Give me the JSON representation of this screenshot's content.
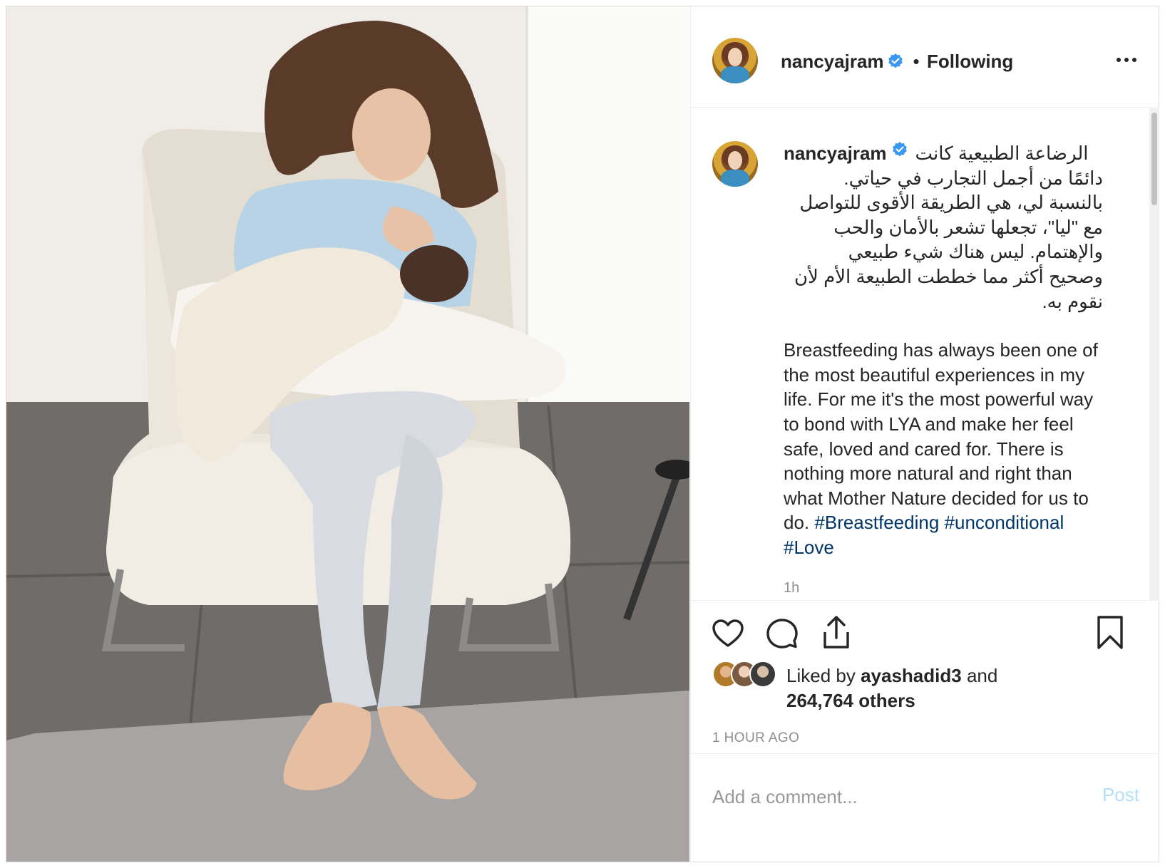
{
  "post": {
    "username": "nancyajram",
    "follow_status": "Following",
    "separator": "•",
    "caption_arabic_first": "الرضاعة الطبيعية كانت",
    "caption_arabic_lines": [
      "دائمًا من أجمل التجارب في حياتي.",
      "بالنسبة لي، هي الطريقة الأقوى للتواصل",
      "مع \"ليا\"، تجعلها تشعر بالأمان والحب",
      "والإهتمام. ليس هناك شيء طبيعي",
      "وصحيح أكثر مما خططت الطبيعة الأم لأن",
      "نقوم به."
    ],
    "caption_english": "Breastfeeding has always been one of the most beautiful experiences in my life. For me it's the most powerful way to bond with LYA and make her feel safe, loved and cared for. There is nothing more natural and right than what Mother Nature decided for us to do.",
    "hashtags": [
      "#Breastfeeding",
      "#unconditional",
      "#Love"
    ],
    "caption_time": "1h",
    "likes": {
      "prefix": "Liked by",
      "user": "ayashadid3",
      "conjunction": "and",
      "count_text": "264,764 others"
    },
    "time_ago": "1 HOUR AGO"
  },
  "comment": {
    "placeholder": "Add a comment...",
    "post_label": "Post"
  },
  "icons": {
    "verified": "verified-badge-icon",
    "more": "more-options-icon",
    "like": "heart-icon",
    "comment": "comment-bubble-icon",
    "share": "share-icon",
    "save": "bookmark-icon"
  },
  "colors": {
    "verified_blue": "#3897f0",
    "hashtag": "#003569",
    "muted": "#8e8e8e",
    "post_button_disabled": "#b2dffc"
  }
}
